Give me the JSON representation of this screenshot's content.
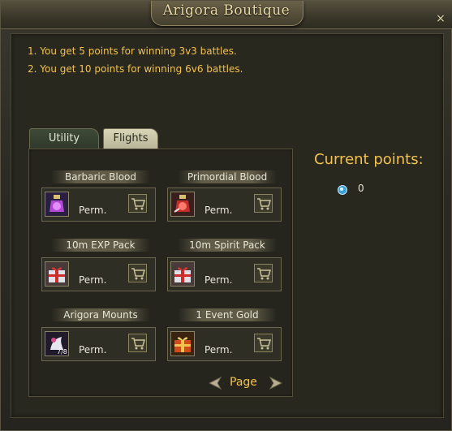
{
  "window": {
    "title": "Arigora Boutique",
    "close_icon": "×"
  },
  "rules": [
    "1. You get 5 points for winning 3v3 battles.",
    "2. You get 10 points for winning 6v6 battles."
  ],
  "tabs": [
    {
      "label": "Utility",
      "active": false
    },
    {
      "label": "Flights",
      "active": true
    }
  ],
  "items": [
    {
      "name": "Barbaric Blood",
      "duration": "Perm.",
      "icon": "purple-potion-icon"
    },
    {
      "name": "Primordial Blood",
      "duration": "Perm.",
      "icon": "red-potion-icon"
    },
    {
      "name": "10m EXP Pack",
      "duration": "Perm.",
      "icon": "gift-box-icon"
    },
    {
      "name": "10m Spirit Pack",
      "duration": "Perm.",
      "icon": "gift-box-icon"
    },
    {
      "name": "Arigora Mounts",
      "duration": "Perm.",
      "icon": "mount-card-icon"
    },
    {
      "name": "1 Event Gold",
      "duration": "Perm.",
      "icon": "gold-gift-icon"
    }
  ],
  "pagination": {
    "label": "Page"
  },
  "points": {
    "title": "Current points:",
    "value": "0",
    "icon": "gem-icon"
  },
  "colors": {
    "accent_gold": "#f2c14e",
    "panel": "#29281f",
    "text_light": "#e6e4d4"
  }
}
